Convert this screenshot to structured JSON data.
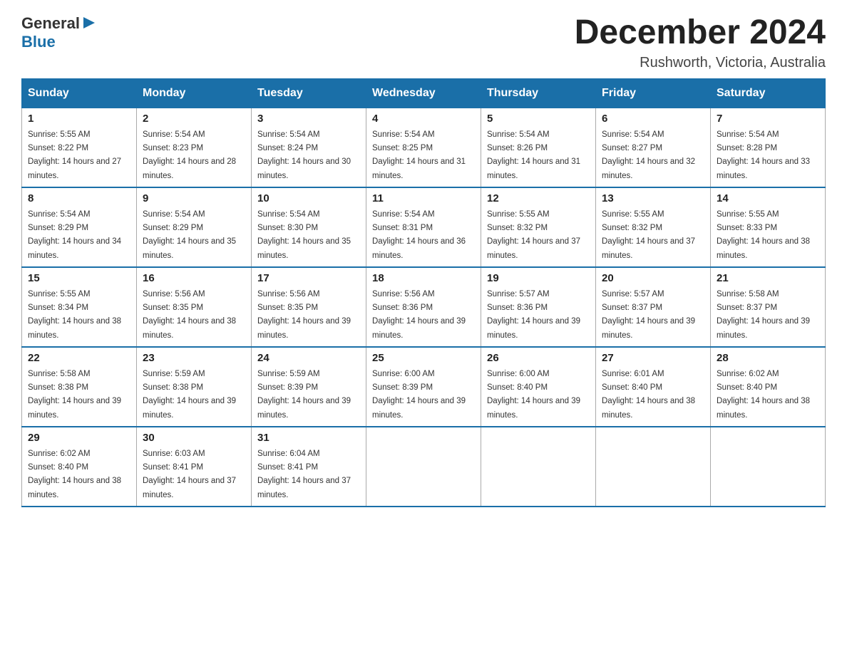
{
  "logo": {
    "text_general": "General",
    "text_blue": "Blue",
    "arrow": "▶"
  },
  "title": "December 2024",
  "subtitle": "Rushworth, Victoria, Australia",
  "days_of_week": [
    "Sunday",
    "Monday",
    "Tuesday",
    "Wednesday",
    "Thursday",
    "Friday",
    "Saturday"
  ],
  "weeks": [
    [
      {
        "day": "1",
        "sunrise": "5:55 AM",
        "sunset": "8:22 PM",
        "daylight": "14 hours and 27 minutes."
      },
      {
        "day": "2",
        "sunrise": "5:54 AM",
        "sunset": "8:23 PM",
        "daylight": "14 hours and 28 minutes."
      },
      {
        "day": "3",
        "sunrise": "5:54 AM",
        "sunset": "8:24 PM",
        "daylight": "14 hours and 30 minutes."
      },
      {
        "day": "4",
        "sunrise": "5:54 AM",
        "sunset": "8:25 PM",
        "daylight": "14 hours and 31 minutes."
      },
      {
        "day": "5",
        "sunrise": "5:54 AM",
        "sunset": "8:26 PM",
        "daylight": "14 hours and 31 minutes."
      },
      {
        "day": "6",
        "sunrise": "5:54 AM",
        "sunset": "8:27 PM",
        "daylight": "14 hours and 32 minutes."
      },
      {
        "day": "7",
        "sunrise": "5:54 AM",
        "sunset": "8:28 PM",
        "daylight": "14 hours and 33 minutes."
      }
    ],
    [
      {
        "day": "8",
        "sunrise": "5:54 AM",
        "sunset": "8:29 PM",
        "daylight": "14 hours and 34 minutes."
      },
      {
        "day": "9",
        "sunrise": "5:54 AM",
        "sunset": "8:29 PM",
        "daylight": "14 hours and 35 minutes."
      },
      {
        "day": "10",
        "sunrise": "5:54 AM",
        "sunset": "8:30 PM",
        "daylight": "14 hours and 35 minutes."
      },
      {
        "day": "11",
        "sunrise": "5:54 AM",
        "sunset": "8:31 PM",
        "daylight": "14 hours and 36 minutes."
      },
      {
        "day": "12",
        "sunrise": "5:55 AM",
        "sunset": "8:32 PM",
        "daylight": "14 hours and 37 minutes."
      },
      {
        "day": "13",
        "sunrise": "5:55 AM",
        "sunset": "8:32 PM",
        "daylight": "14 hours and 37 minutes."
      },
      {
        "day": "14",
        "sunrise": "5:55 AM",
        "sunset": "8:33 PM",
        "daylight": "14 hours and 38 minutes."
      }
    ],
    [
      {
        "day": "15",
        "sunrise": "5:55 AM",
        "sunset": "8:34 PM",
        "daylight": "14 hours and 38 minutes."
      },
      {
        "day": "16",
        "sunrise": "5:56 AM",
        "sunset": "8:35 PM",
        "daylight": "14 hours and 38 minutes."
      },
      {
        "day": "17",
        "sunrise": "5:56 AM",
        "sunset": "8:35 PM",
        "daylight": "14 hours and 39 minutes."
      },
      {
        "day": "18",
        "sunrise": "5:56 AM",
        "sunset": "8:36 PM",
        "daylight": "14 hours and 39 minutes."
      },
      {
        "day": "19",
        "sunrise": "5:57 AM",
        "sunset": "8:36 PM",
        "daylight": "14 hours and 39 minutes."
      },
      {
        "day": "20",
        "sunrise": "5:57 AM",
        "sunset": "8:37 PM",
        "daylight": "14 hours and 39 minutes."
      },
      {
        "day": "21",
        "sunrise": "5:58 AM",
        "sunset": "8:37 PM",
        "daylight": "14 hours and 39 minutes."
      }
    ],
    [
      {
        "day": "22",
        "sunrise": "5:58 AM",
        "sunset": "8:38 PM",
        "daylight": "14 hours and 39 minutes."
      },
      {
        "day": "23",
        "sunrise": "5:59 AM",
        "sunset": "8:38 PM",
        "daylight": "14 hours and 39 minutes."
      },
      {
        "day": "24",
        "sunrise": "5:59 AM",
        "sunset": "8:39 PM",
        "daylight": "14 hours and 39 minutes."
      },
      {
        "day": "25",
        "sunrise": "6:00 AM",
        "sunset": "8:39 PM",
        "daylight": "14 hours and 39 minutes."
      },
      {
        "day": "26",
        "sunrise": "6:00 AM",
        "sunset": "8:40 PM",
        "daylight": "14 hours and 39 minutes."
      },
      {
        "day": "27",
        "sunrise": "6:01 AM",
        "sunset": "8:40 PM",
        "daylight": "14 hours and 38 minutes."
      },
      {
        "day": "28",
        "sunrise": "6:02 AM",
        "sunset": "8:40 PM",
        "daylight": "14 hours and 38 minutes."
      }
    ],
    [
      {
        "day": "29",
        "sunrise": "6:02 AM",
        "sunset": "8:40 PM",
        "daylight": "14 hours and 38 minutes."
      },
      {
        "day": "30",
        "sunrise": "6:03 AM",
        "sunset": "8:41 PM",
        "daylight": "14 hours and 37 minutes."
      },
      {
        "day": "31",
        "sunrise": "6:04 AM",
        "sunset": "8:41 PM",
        "daylight": "14 hours and 37 minutes."
      },
      null,
      null,
      null,
      null
    ]
  ]
}
